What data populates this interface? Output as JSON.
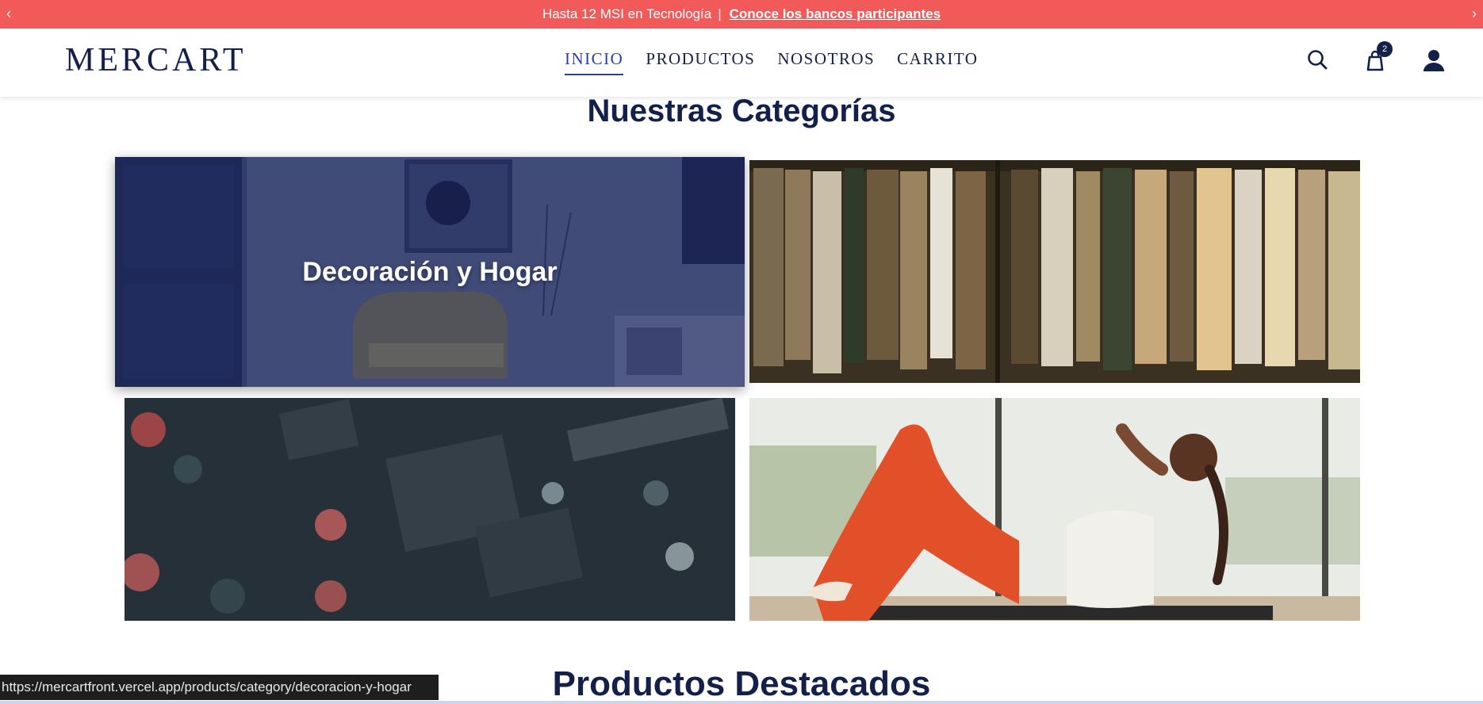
{
  "promo": {
    "text": "Hasta 12 MSI en Tecnología",
    "separator": "|",
    "link": "Conoce los bancos participantes",
    "prev_icon": "chevron-left-icon",
    "next_icon": "chevron-right-icon"
  },
  "header": {
    "logo": "MERCART",
    "nav": [
      {
        "label": "INICIO",
        "active": true
      },
      {
        "label": "PRODUCTOS",
        "active": false
      },
      {
        "label": "NOSOTROS",
        "active": false
      },
      {
        "label": "CARRITO",
        "active": false
      }
    ],
    "icons": [
      "search-icon",
      "shopping-bag-icon",
      "user-icon"
    ],
    "cart_count": "2"
  },
  "categories": {
    "title": "Nuestras Categorías",
    "tiles": [
      {
        "label": "Decoración y Hogar",
        "image": "living-room-photo"
      },
      {
        "image": "clothing-rack-photo"
      },
      {
        "image": "circuit-board-photo"
      },
      {
        "image": "woman-exercising-photo"
      }
    ]
  },
  "featured": {
    "title": "Productos Destacados"
  },
  "status_bar": {
    "url": "https://mercartfront.vercel.app/products/category/decoracion-y-hogar"
  },
  "colors": {
    "promo_bg": "#f25a5a",
    "brand_navy": "#13204a",
    "active_nav": "#2c3ea8"
  }
}
